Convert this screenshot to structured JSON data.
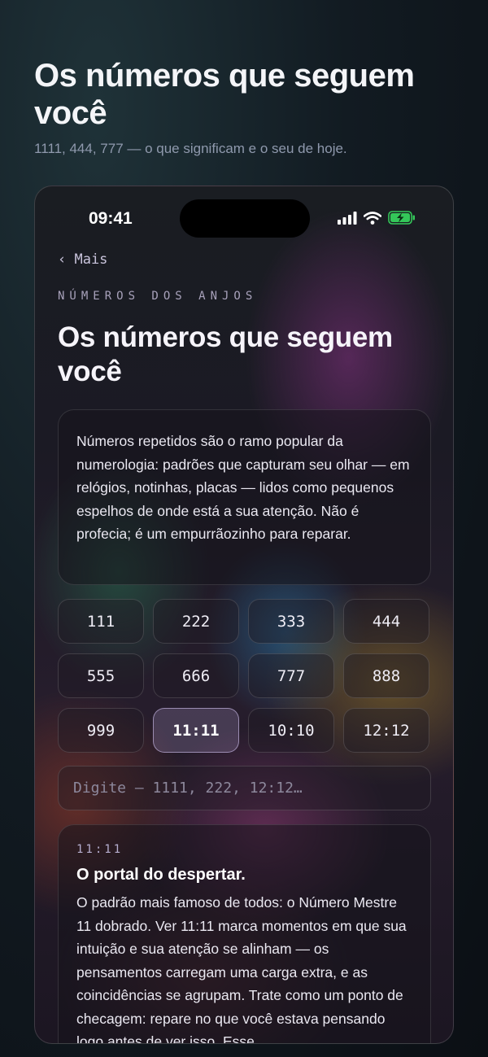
{
  "header": {
    "title": "Os números que seguem você",
    "subtitle": "1111, 444, 777 — o que significam e o seu de hoje."
  },
  "status_bar": {
    "time": "09:41",
    "icons": [
      "signal-icon",
      "wifi-icon",
      "battery-charging-icon"
    ],
    "battery_color": "#34c759"
  },
  "screen": {
    "back_label": "‹ Mais",
    "section_label": "NÚMEROS DOS ANJOS",
    "title": "Os números que seguem você",
    "intro": "Números repetidos são o ramo popular da numerologia: padrões que capturam seu olhar — em relógios, notinhas, placas — lidos como pequenos espelhos de onde está a sua atenção. Não é profecia; é um empurrãozinho para reparar.",
    "numbers": [
      "111",
      "222",
      "333",
      "444",
      "555",
      "666",
      "777",
      "888",
      "999",
      "11:11",
      "10:10",
      "12:12"
    ],
    "selected": "11:11",
    "search_placeholder": "Digite — 1111, 222, 12:12…",
    "detail": {
      "code": "11:11",
      "title": "O portal do despertar.",
      "body": "O padrão mais famoso de todos: o Número Mestre 11 dobrado. Ver 11:11 marca momentos em que sua intuição e sua atenção se alinham — os pensamentos carregam uma carga extra, e as coincidências se agrupam. Trate como um ponto de checagem: repare no que você estava pensando logo antes de ver isso. Esse"
    }
  }
}
